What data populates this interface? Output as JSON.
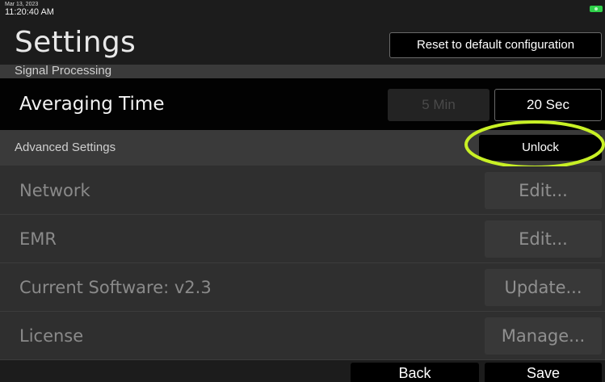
{
  "status": {
    "date": "Mar 13, 2023",
    "time": "11:20:40 AM",
    "battery_color": "#2fd14a"
  },
  "header": {
    "title": "Settings",
    "reset_label": "Reset to default configuration"
  },
  "signal_processing": {
    "section_label": "Signal Processing",
    "averaging_time": {
      "label": "Averaging Time",
      "options": [
        "5 Min",
        "20 Sec"
      ],
      "selected": "20 Sec"
    }
  },
  "advanced": {
    "section_label": "Advanced Settings",
    "unlock_label": "Unlock",
    "highlight_color": "#c8f025",
    "rows": [
      {
        "label": "Network",
        "button": "Edit..."
      },
      {
        "label": "EMR",
        "button": "Edit..."
      },
      {
        "label": "Current Software: v2.3",
        "button": "Update..."
      },
      {
        "label": "License",
        "button": "Manage..."
      }
    ]
  },
  "footer": {
    "back_label": "Back",
    "save_label": "Save"
  }
}
